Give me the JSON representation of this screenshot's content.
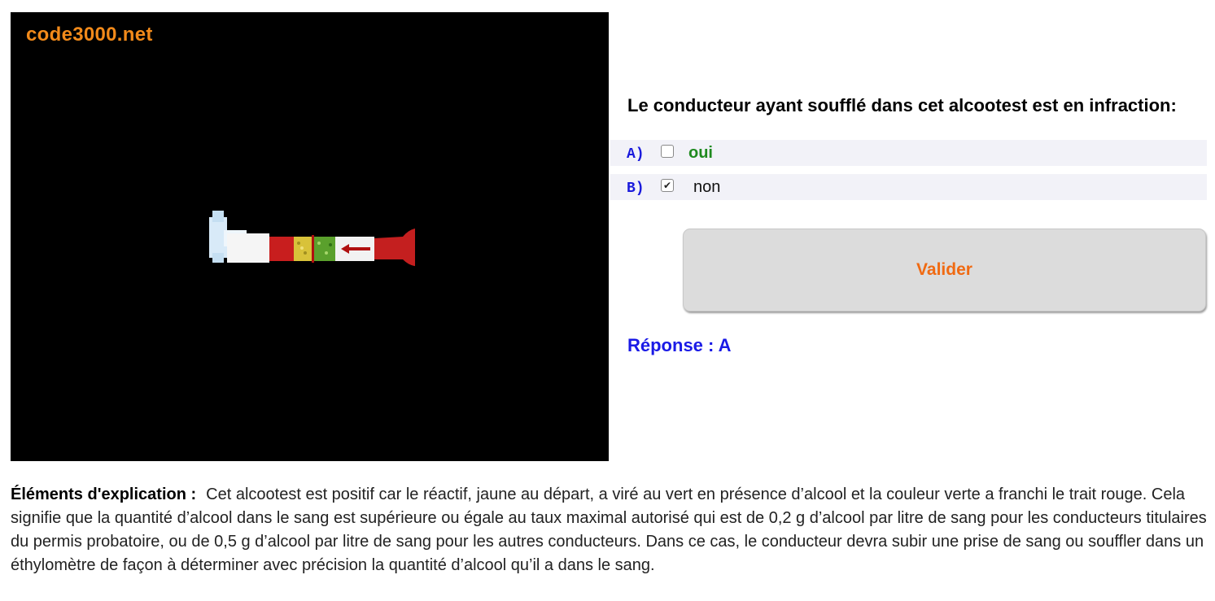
{
  "media": {
    "brand": "code3000.net"
  },
  "question": {
    "text": "Le conducteur ayant soufflé dans cet alcootest est en infraction:"
  },
  "answers": [
    {
      "letter": "A)",
      "label": "oui",
      "checked": false
    },
    {
      "letter": "B)",
      "label": "non",
      "checked": true
    }
  ],
  "validate_label": "Valider",
  "result": "Réponse : A",
  "explanation": {
    "label": "Éléments d'explication :",
    "text": "Cet alcootest est positif car le réactif, jaune au départ, a viré au vert en présence d’alcool et la couleur verte a franchi le trait rouge. Cela signifie que la quantité d’alcool dans le sang est supérieure ou égale au taux maximal autorisé qui est de 0,2 g d’alcool par litre de sang pour les conducteurs titulaires du permis probatoire, ou de 0,5 g d’alcool par litre de sang pour les autres conducteurs. Dans ce cas, le conducteur devra subir une prise de sang ou souffler dans un éthylomètre de façon à déterminer avec précision la quantité d’alcool qu’il a dans le sang."
  },
  "colors": {
    "brand": "#f28a1a",
    "letter": "#1a1adc",
    "correct_option": "#1f8a1f",
    "validate_text": "#f06a12",
    "result": "#1a1ae6"
  }
}
